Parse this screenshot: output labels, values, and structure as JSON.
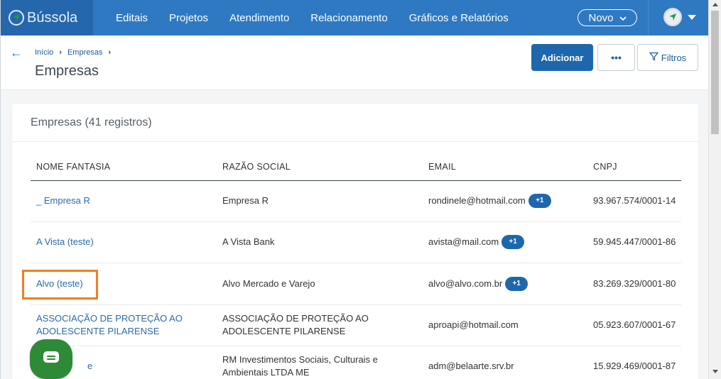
{
  "brand": {
    "name": "Bússola",
    "logo_icon": "compass-icon"
  },
  "nav": {
    "items": [
      "Editais",
      "Projetos",
      "Atendimento",
      "Relacionamento",
      "Gráficos e Relatórios"
    ],
    "novo_label": "Novo"
  },
  "breadcrumb": {
    "home": "Início",
    "current": "Empresas"
  },
  "page": {
    "title": "Empresas"
  },
  "actions": {
    "add_label": "Adicionar",
    "more_label": "•••",
    "filter_label": "Filtros"
  },
  "card": {
    "title": "Empresas (41 registros)"
  },
  "table": {
    "headers": [
      "NOME FANTASIA",
      "RAZÃO SOCIAL",
      "EMAIL",
      "CNPJ"
    ],
    "rows": [
      {
        "name": "_ Empresa R",
        "razao": "Empresa R",
        "email": "rondinele@hotmail.com",
        "badge": "+1",
        "cnpj": "93.967.574/0001-14"
      },
      {
        "name": "A Vista (teste)",
        "razao": "A Vista Bank",
        "email": "avista@mail.com",
        "badge": "+1",
        "cnpj": "59.945.447/0001-86"
      },
      {
        "name": "Alvo (teste)",
        "razao": "Alvo Mercado e Varejo",
        "email": "alvo@alvo.com.br",
        "badge": "+1",
        "cnpj": "83.269.329/0001-80"
      },
      {
        "name": "ASSOCIAÇÃO DE PROTEÇÃO AO ADOLESCENTE PILARENSE",
        "razao": "ASSOCIAÇÃO DE PROTEÇÃO AO ADOLESCENTE PILARENSE",
        "email": "aproapi@hotmail.com",
        "badge": "",
        "cnpj": "05.923.607/0001-67"
      },
      {
        "name": "e",
        "razao": "RM Investimentos Sociais, Culturais e Ambientais LTDA ME",
        "email": "adm@belaarte.srv.br",
        "badge": "",
        "cnpj": "15.929.469/0001-87"
      }
    ]
  },
  "colors": {
    "nav_bg": "#2f78c2",
    "primary": "#1e67ac",
    "link": "#2d6aa6",
    "highlight": "#f07f22",
    "chat": "#2e8a37"
  }
}
